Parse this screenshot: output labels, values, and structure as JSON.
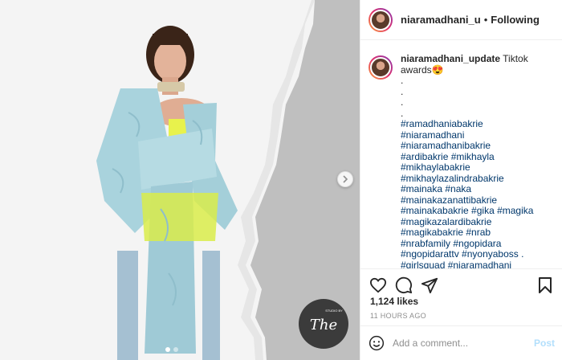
{
  "post": {
    "author": "niaramadhani_u",
    "follow_status": "Following",
    "dot": "•",
    "watermark_text": "The",
    "watermark_subtext": "STUDIO BY"
  },
  "caption": {
    "user": "niaramadhani_update",
    "text": "Tiktok awards😍",
    "lines": [
      ".",
      ".",
      ".",
      "."
    ],
    "hashtags": [
      "#ramadhaniabakrie",
      "#niaramadhani",
      "#niaramadhanibakrie",
      "#ardibakrie #mikhayla",
      "#mikhaylabakrie",
      "#mikhaylazalindrabakrie",
      "#mainaka #naka",
      "#mainakazanattibakrie",
      "#mainakabakrie #gika #magika",
      "#magikazalardibakrie",
      "#magikabakrie #nrab",
      "#nrabfamily #ngopidara",
      "#ngopidarattv #nyonyaboss .",
      "#girlsquad #niaramadhani"
    ]
  },
  "engagement": {
    "likes": "1,124 likes",
    "time": "11 HOURS AGO"
  },
  "comment": {
    "placeholder": "Add a comment...",
    "post_label": "Post"
  },
  "icons": {
    "like": "heart-icon",
    "comment": "comment-icon",
    "share": "share-icon",
    "save": "bookmark-icon",
    "emoji": "emoji-icon",
    "next": "chevron-right-icon"
  },
  "colors": {
    "hashtag": "#00376b",
    "post_button": "#b2dffc",
    "muted": "#8e8e8e"
  }
}
